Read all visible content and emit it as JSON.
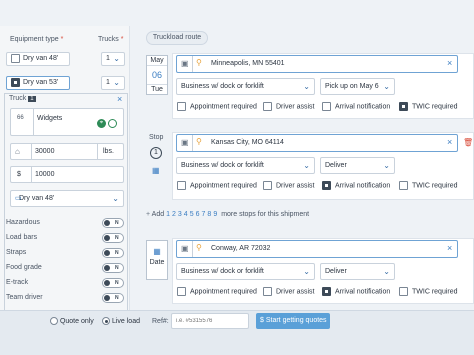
{
  "sidebar": {
    "equipment_label": "Equipment type",
    "req": "*",
    "trucks_label": "Trucks",
    "dry_van_48": "Dry van 48'",
    "dry_van_53": "Dry van 53'",
    "qty_48": "1",
    "qty_53": "1",
    "truck_label": "Truck",
    "truck_num": "1",
    "close": "×",
    "commodity_code": "66",
    "commodity": "Widgets",
    "weight": "30000",
    "weight_unit": "lbs.",
    "value_currency": "$",
    "value": "10000",
    "equipment_select": "Dry van 48'",
    "attributes": [
      {
        "label": "Hazardous",
        "state": "N"
      },
      {
        "label": "Load bars",
        "state": "N"
      },
      {
        "label": "Straps",
        "state": "N"
      },
      {
        "label": "Food grade",
        "state": "N"
      },
      {
        "label": "E-track",
        "state": "N"
      },
      {
        "label": "Team driver",
        "state": "N"
      }
    ]
  },
  "main": {
    "tab_label": "Truckload route",
    "stops": [
      {
        "date_month": "May",
        "date_day": "06",
        "date_weekday": "Tue",
        "address": "Minneapolis, MN 55401",
        "location_type": "Business w/ dock or forklift",
        "action": "Pick up on May 6",
        "options": [
          {
            "label": "Appointment required",
            "checked": false
          },
          {
            "label": "Driver assist",
            "checked": false
          },
          {
            "label": "Arrival notification",
            "checked": false
          },
          {
            "label": "TWIC required",
            "checked": true
          }
        ]
      },
      {
        "stop_label": "Stop",
        "stop_num": "1",
        "address": "Kansas City, MO 64114",
        "location_type": "Business w/ dock or forklift",
        "action": "Deliver",
        "options": [
          {
            "label": "Appointment required",
            "checked": false
          },
          {
            "label": "Driver assist",
            "checked": false
          },
          {
            "label": "Arrival notification",
            "checked": true
          },
          {
            "label": "TWIC required",
            "checked": false
          }
        ]
      },
      {
        "date_label": "Date",
        "address": "Conway, AR 72032",
        "location_type": "Business w/ dock or forklift",
        "action": "Deliver",
        "options": [
          {
            "label": "Appointment required",
            "checked": false
          },
          {
            "label": "Driver assist",
            "checked": false
          },
          {
            "label": "Arrival notification",
            "checked": true
          },
          {
            "label": "TWIC required",
            "checked": false
          }
        ]
      }
    ],
    "add_label": "Add",
    "add_numbers": [
      "1",
      "2",
      "3",
      "4",
      "5",
      "6",
      "7",
      "8",
      "9"
    ],
    "add_suffix": "more stops for this shipment"
  },
  "footer": {
    "quote_only": "Quote only",
    "live_load": "Live load",
    "ref_label": "Ref#:",
    "ref_placeholder": "i.e. #5315576",
    "cta": "$ Start getting quotes"
  }
}
